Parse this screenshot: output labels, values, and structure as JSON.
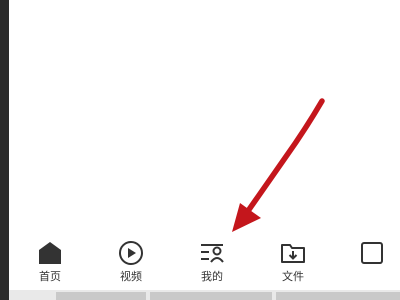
{
  "tabs": [
    {
      "label": "首页",
      "icon": "home-icon"
    },
    {
      "label": "视频",
      "icon": "play-circle-icon"
    },
    {
      "label": "我的",
      "icon": "profile-list-icon"
    },
    {
      "label": "文件",
      "icon": "folder-download-icon"
    },
    {
      "label": "",
      "icon": "square-icon"
    }
  ],
  "colors": {
    "arrow": "#c4161c",
    "icon": "#333333",
    "text": "#333333",
    "background": "#ffffff"
  }
}
